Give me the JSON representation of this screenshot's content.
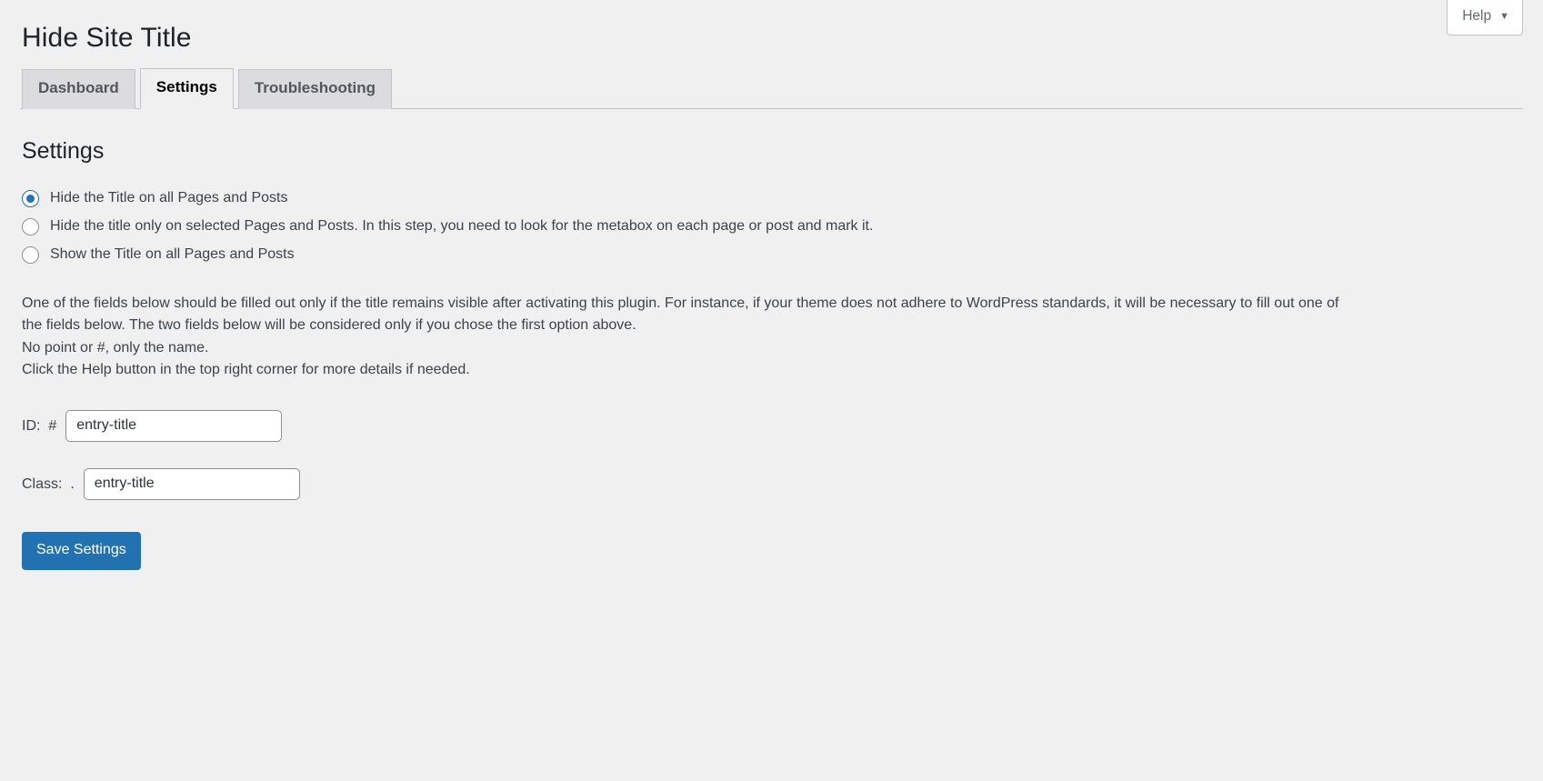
{
  "help": {
    "label": "Help",
    "caret": "chevron-down-icon"
  },
  "header": {
    "title": "Hide Site Title"
  },
  "tabs": [
    {
      "label": "Dashboard",
      "active": false
    },
    {
      "label": "Settings",
      "active": true
    },
    {
      "label": "Troubleshooting",
      "active": false
    }
  ],
  "main": {
    "section_title": "Settings",
    "radios": [
      {
        "label": "Hide the Title on all Pages and Posts",
        "checked": true
      },
      {
        "label": "Hide the title only on selected Pages and Posts. In this step, you need to look for the metabox on each page or post and mark it.",
        "checked": false
      },
      {
        "label": "Show the Title on all Pages and Posts",
        "checked": false
      }
    ],
    "description": {
      "line1": "One of the fields below should be filled out only if the title remains visible after activating this plugin. For instance, if your theme does not adhere to WordPress standards, it will be necessary to fill out one of",
      "line2": "the fields below. The two fields below will be considered only if you chose the first option above.",
      "line3": "No point or #, only the name.",
      "line4": "Click the Help button in the top right corner for more details if needed."
    },
    "fields": {
      "id": {
        "label": "ID:  #",
        "value": "entry-title",
        "placeholder": ""
      },
      "class": {
        "label": "Class:  .",
        "value": "entry-title",
        "placeholder": ""
      }
    },
    "save_label": "Save Settings"
  },
  "colors": {
    "accent": "#2271b1",
    "page_bg": "#f0f0f1",
    "tab_inactive_bg": "#dcdcde",
    "border": "#c3c4c7",
    "text": "#3c434a"
  }
}
